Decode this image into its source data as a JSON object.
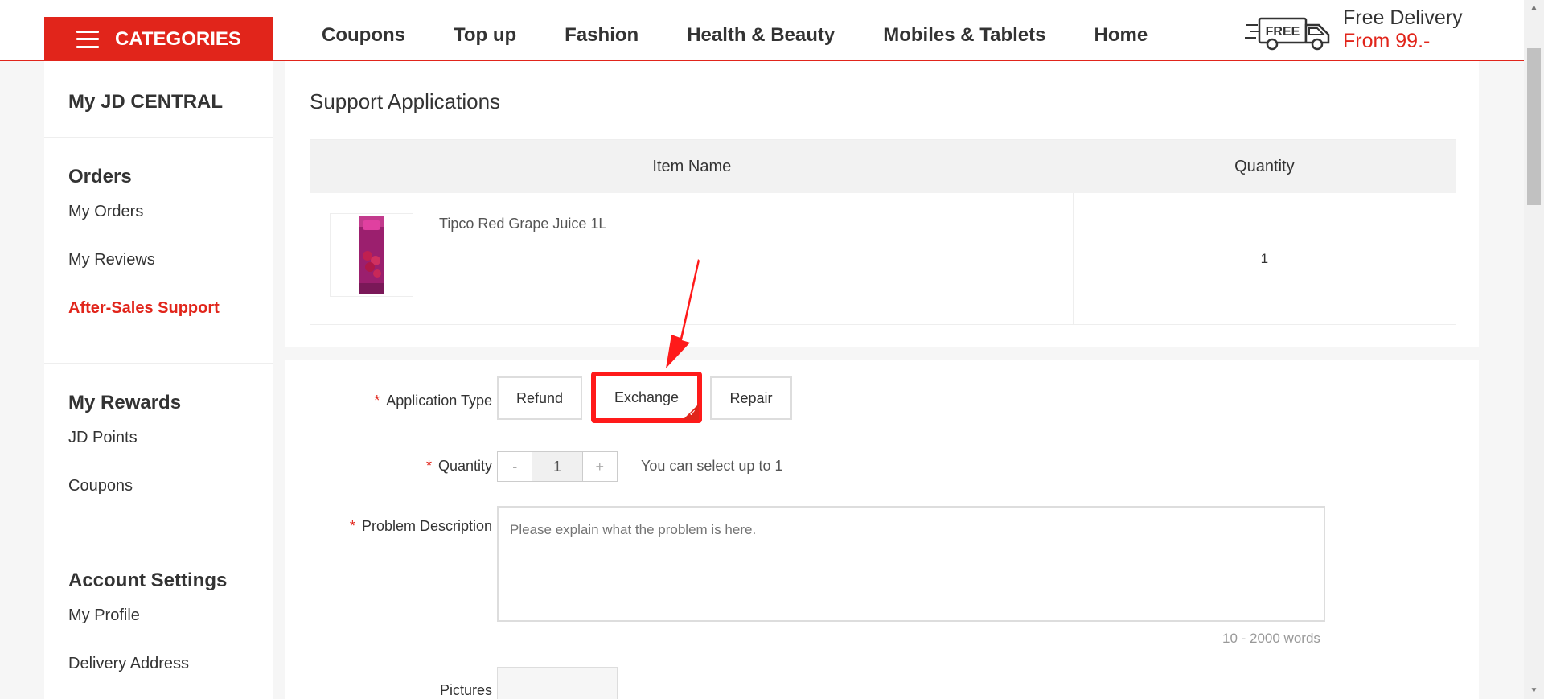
{
  "header": {
    "categories_label": "CATEGORIES",
    "nav": [
      "Coupons",
      "Top up",
      "Fashion",
      "Health & Beauty",
      "Mobiles & Tablets",
      "Home"
    ],
    "delivery_badge": "FREE",
    "delivery_line1": "Free Delivery",
    "delivery_line2": "From 99.-"
  },
  "sidebar": {
    "home": "My JD CENTRAL",
    "orders_title": "Orders",
    "orders_items": [
      "My Orders",
      "My Reviews",
      "After-Sales Support"
    ],
    "rewards_title": "My Rewards",
    "rewards_items": [
      "JD Points",
      "Coupons"
    ],
    "account_title": "Account Settings",
    "account_items": [
      "My Profile",
      "Delivery Address"
    ]
  },
  "main": {
    "title": "Support Applications",
    "table_headers": [
      "Item Name",
      "Quantity"
    ],
    "item": {
      "name": "Tipco Red Grape Juice 1L",
      "quantity": "1"
    },
    "form": {
      "application_type_label": "Application Type",
      "types": [
        "Refund",
        "Exchange",
        "Repair"
      ],
      "selected_type": "Exchange",
      "quantity_label": "Quantity",
      "quantity_minus": "-",
      "quantity_value": "1",
      "quantity_plus": "+",
      "quantity_hint": "You can select up to 1",
      "problem_label": "Problem Description",
      "problem_placeholder": "Please explain what the problem is here.",
      "words_hint": "10 - 2000 words",
      "pictures_label": "Pictures",
      "required_mark": "*"
    }
  },
  "colors": {
    "accent": "#e1251b",
    "highlight": "#ff1a1a"
  }
}
